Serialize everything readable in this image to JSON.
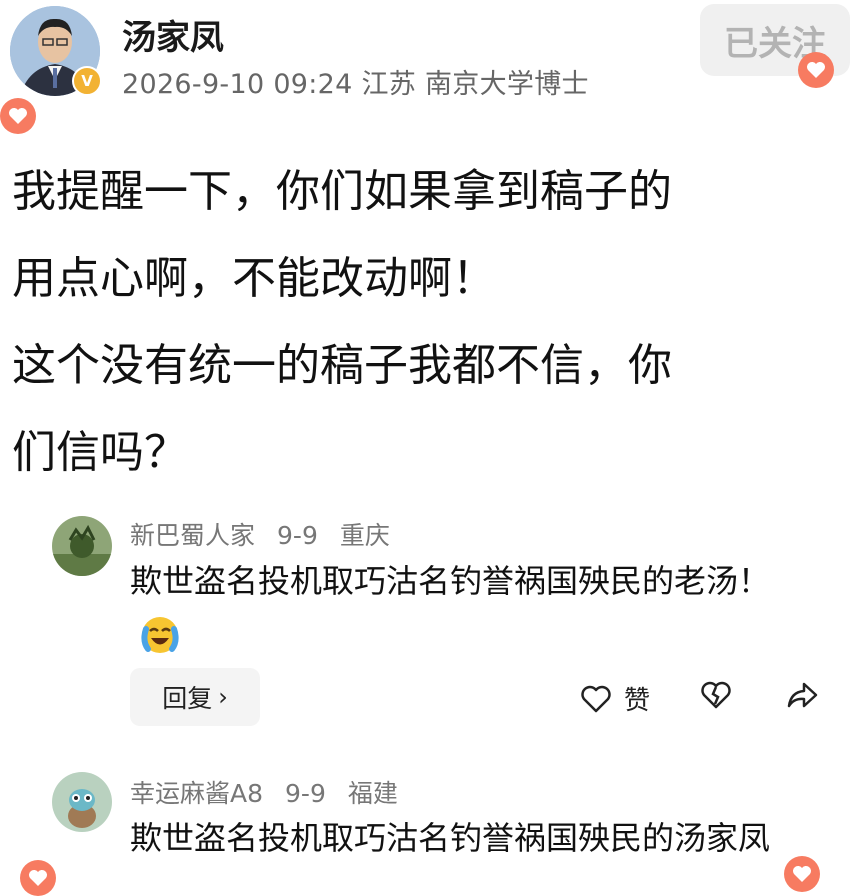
{
  "post": {
    "author": "汤家凤",
    "verified_badge": "V",
    "meta": "2026-9-10 09:24 江苏 南京大学博士",
    "follow_label": "已关注",
    "text_lines": [
      "我提醒一下，你们如果拿到稿子的",
      "用点心啊，不能改动啊！",
      "这个没有统一的稿子我都不信，你",
      "们信吗？"
    ]
  },
  "comments": [
    {
      "name": "新巴蜀人家",
      "date": "9-9",
      "location": "重庆",
      "text": "欺世盗名投机取巧沽名钓誉祸国殃民的老汤！",
      "emoji": "laughing-crying-emoji",
      "reply_label": "回复",
      "like_label": "赞"
    },
    {
      "name": "幸运麻酱A8",
      "date": "9-9",
      "location": "福建",
      "text": "欺世盗名投机取巧沽名钓誉祸国殃民的汤家凤"
    }
  ],
  "icons": [
    "heart-icon",
    "broken-heart-icon",
    "share-icon",
    "chevron-right-icon"
  ],
  "colors": {
    "accent": "#f77b61",
    "verified": "#f2b233",
    "meta_text": "#666666"
  }
}
